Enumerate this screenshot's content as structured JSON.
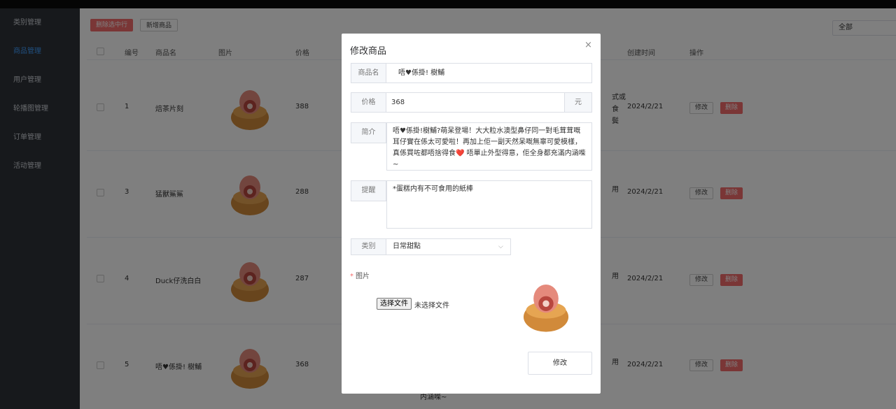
{
  "sidebar": {
    "items": [
      {
        "label": "类别管理"
      },
      {
        "label": "商品管理",
        "active": true
      },
      {
        "label": "用户管理"
      },
      {
        "label": "轮播图管理"
      },
      {
        "label": "订单管理"
      },
      {
        "label": "活动管理"
      }
    ]
  },
  "toolbar": {
    "delete_selected_label": "删除选中行",
    "add_product_label": "新增商品",
    "filter_value": "全部"
  },
  "table": {
    "headers": {
      "id": "编号",
      "name": "商品名",
      "image": "图片",
      "price": "价格",
      "created": "创建时间",
      "actions": "操作"
    },
    "edit_label": "修改",
    "delete_label": "删除",
    "rows": [
      {
        "id": "1",
        "name": "焙茶片刻",
        "price": "388",
        "peek1": "式或",
        "peek2": "食",
        "peek3": "鬓",
        "created": "2024/2/21"
      },
      {
        "id": "3",
        "name": "猛獸鯊鯊",
        "price": "288",
        "peek1": "用",
        "peek2": "",
        "peek3": "",
        "created": "2024/2/21"
      },
      {
        "id": "4",
        "name": "Duck仔洗白白",
        "price": "287",
        "peek1": "用",
        "peek2": "",
        "peek3": "",
        "created": "2024/2/21"
      },
      {
        "id": "5",
        "name": "唔♥係掛! 樹鯆",
        "price": "368",
        "peek1": "用",
        "peek2": "",
        "peek3": "",
        "created": "2024/2/21"
      }
    ],
    "bottom_peek": "内涵喍~"
  },
  "dialog": {
    "title": "修改商品",
    "close_icon": "×",
    "name_label": "商品名",
    "name_value": "唔♥係掛! 樹鯆",
    "price_label": "价格",
    "price_value": "368",
    "price_suffix": "元",
    "intro_label": "简介",
    "intro_value": "唔♥係掛!樹鯆?萌呆登場！大大粒水澳型鼻仔同一對毛茸茸嘅耳仔實在係太可愛啦！再加上佢一副天然呆嘅無辜可愛模樣，真係買咗都唔捨得食❤️ 唔單止外型得意，佢全身都充滿内涵喍~",
    "reminder_label": "提醒",
    "reminder_value": "*蛋糕内有不可食用的紙棒",
    "category_label": "类别",
    "category_value": "日常甜點",
    "image_label": "图片",
    "file_button": "选择文件",
    "file_status": "未选择文件",
    "submit_label": "修改"
  },
  "colors": {
    "sidebar_bg": "#2e3238",
    "accent": "#409eff",
    "danger": "#f56c6c"
  }
}
